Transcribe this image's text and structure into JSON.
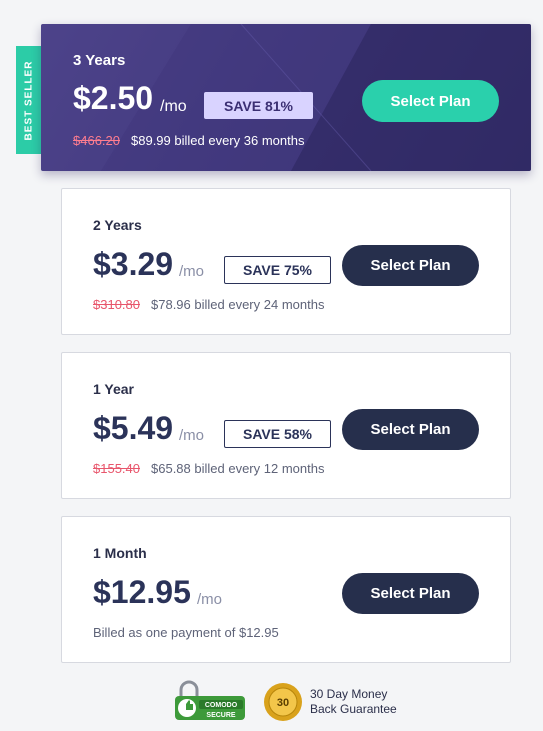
{
  "ribbon": {
    "label": "BEST SELLER"
  },
  "plans": [
    {
      "term": "3 Years",
      "price": "$2.50",
      "unit": "/mo",
      "save": "SAVE 81%",
      "old_price": "$466.20",
      "billed": "$89.99 billed every 36 months",
      "button": "Select Plan"
    },
    {
      "term": "2 Years",
      "price": "$3.29",
      "unit": "/mo",
      "save": "SAVE 75%",
      "old_price": "$310.80",
      "billed": "$78.96 billed every 24 months",
      "button": "Select Plan"
    },
    {
      "term": "1 Year",
      "price": "$5.49",
      "unit": "/mo",
      "save": "SAVE 58%",
      "old_price": "$155.40",
      "billed": "$65.88 billed every 12 months",
      "button": "Select Plan"
    },
    {
      "term": "1 Month",
      "price": "$12.95",
      "unit": "/mo",
      "billed": "Billed as one payment of $12.95",
      "button": "Select Plan"
    }
  ],
  "trust": {
    "comodo_top": "COMODO",
    "comodo_bottom": "SECURE",
    "medal_text": "30",
    "guarantee_line1": "30 Day Money",
    "guarantee_line2": "Back Guarantee"
  },
  "colors": {
    "featured_bg": "#3e3579",
    "teal": "#2ad0ac",
    "dark_button": "#262f4c",
    "strike": "#e8566c"
  },
  "icons": [
    "padlock-icon",
    "thumbs-up-icon",
    "gold-medal-icon"
  ]
}
